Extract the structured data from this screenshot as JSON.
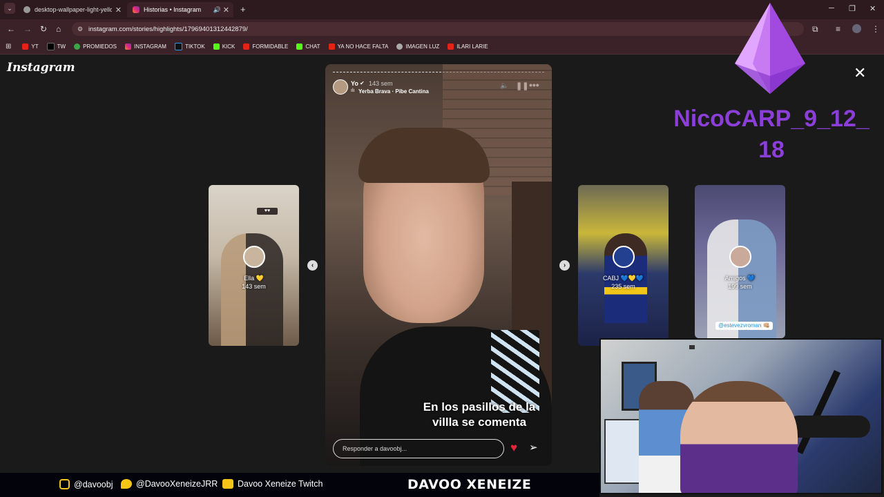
{
  "browser": {
    "tabs": [
      {
        "label": "desktop-wallpaper-light-yellow",
        "active": false
      },
      {
        "label": "Historias • Instagram",
        "active": true
      }
    ],
    "url": "instagram.com/stories/highlights/17969401312442879/",
    "bookmarks": [
      "YT",
      "TW",
      "PROMIEDOS",
      "INSTAGRAM",
      "TIKTOK",
      "KICK",
      "FORMIDABLE",
      "CHAT",
      "YA NO HACE FALTA",
      "IMAGEN LUZ",
      "ILARI LARIE"
    ]
  },
  "instagram": {
    "logo": "Instagram",
    "story": {
      "user": "Yo",
      "time": "143 sem",
      "song": "Yerba Brava · Pibe Cantina",
      "caption": "En los pasillos de la villla se comenta",
      "reply_placeholder": "Responder a davoobj..."
    },
    "highlights": [
      {
        "title": "Ella 💛",
        "time": "143 sem"
      },
      {
        "title": "CABJ 💙💛💙",
        "time": "235 sem"
      },
      {
        "title": "Amigos 💙",
        "time": "199 sem"
      }
    ],
    "mention_tag": "@estevezvroman 👊🏼"
  },
  "overlay": {
    "brand_name": "NicoCARP_9_12_18",
    "title": "DAVOO XENEIZE",
    "socials": [
      {
        "icon": "instagram-icon",
        "label": "@davoobj"
      },
      {
        "icon": "twitter-icon",
        "label": "@DavooXeneizeJRR"
      },
      {
        "icon": "twitch-icon",
        "label": "Davoo Xeneize Twitch"
      }
    ]
  },
  "colors": {
    "tabbar": "#2c1a1e",
    "toolbar": "#3b2228",
    "accent_purple": "#8b3fd8",
    "heart_red": "#e3263a"
  }
}
